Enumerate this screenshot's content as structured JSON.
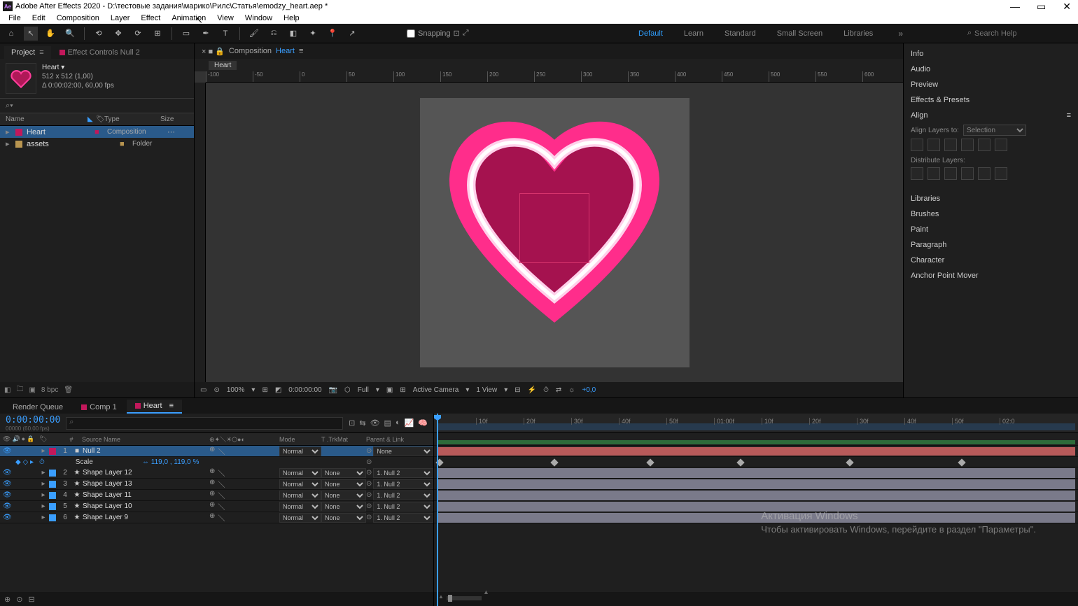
{
  "app": {
    "title": "Adobe After Effects 2020 - D:\\тестовые задания\\марико\\Рилс\\Статья\\emodzy_heart.aep *"
  },
  "menu": [
    "File",
    "Edit",
    "Composition",
    "Layer",
    "Effect",
    "Animation",
    "View",
    "Window",
    "Help"
  ],
  "toolbar": {
    "snapping_label": "Snapping"
  },
  "workspaces": {
    "default": "Default",
    "learn": "Learn",
    "standard": "Standard",
    "small": "Small Screen",
    "libraries": "Libraries"
  },
  "search": {
    "placeholder": "Search Help"
  },
  "project": {
    "tab_project": "Project",
    "tab_effects": "Effect Controls Null 2",
    "comp_name": "Heart ▾",
    "comp_dims": "512 x 512 (1,00)",
    "comp_dur": "Δ 0:00:02:00, 60,00 fps",
    "filter": "⌕▾",
    "head_name": "Name",
    "head_type": "Type",
    "head_size": "Size",
    "items": [
      {
        "name": "Heart",
        "type": "Composition",
        "folder": false,
        "selected": true
      },
      {
        "name": "assets",
        "type": "Folder",
        "folder": true,
        "selected": false
      }
    ],
    "footer_bpc": "8 bpc"
  },
  "comp": {
    "tab_label": "Composition",
    "tab_name": "Heart",
    "breadcrumb": "Heart",
    "ruler_ticks": [
      "-100",
      "-50",
      "0",
      "50",
      "100",
      "150",
      "200",
      "250",
      "300",
      "350",
      "400",
      "450",
      "500",
      "550",
      "600"
    ],
    "footer": {
      "zoom": "100%",
      "time": "0:00:00:00",
      "res": "Full",
      "camera": "Active Camera",
      "view": "1 View",
      "exp": "+0,0"
    }
  },
  "right": {
    "info": "Info",
    "audio": "Audio",
    "preview": "Preview",
    "effects": "Effects & Presets",
    "align": "Align",
    "align_to": "Align Layers to:",
    "align_sel": "Selection",
    "distribute": "Distribute Layers:",
    "libraries": "Libraries",
    "brushes": "Brushes",
    "paint": "Paint",
    "paragraph": "Paragraph",
    "character": "Character",
    "anchor": "Anchor Point Mover"
  },
  "timeline": {
    "tab_rq": "Render Queue",
    "tab_c1": "Comp 1",
    "tab_heart": "Heart",
    "timecode": "0:00:00:00",
    "timecode_sub": "00000 (60.00 fps)",
    "col_source": "Source Name",
    "col_mode": "Mode",
    "col_trk": "T  .TrkMat",
    "col_parent": "Parent & Link",
    "ruler": [
      "10f",
      "20f",
      "30f",
      "40f",
      "50f",
      "01:00f",
      "10f",
      "20f",
      "30f",
      "40f",
      "50f",
      "02:0"
    ],
    "layers": [
      {
        "idx": 1,
        "name": "Null 2",
        "color": "#c2185b",
        "icon": "■",
        "mode": "Normal",
        "trk": "",
        "parent": "None",
        "sel": true
      },
      {
        "idx": 2,
        "name": "Shape Layer 12",
        "color": "#3a9eff",
        "icon": "★",
        "mode": "Normal",
        "trk": "None",
        "parent": "1. Null 2"
      },
      {
        "idx": 3,
        "name": "Shape Layer 13",
        "color": "#3a9eff",
        "icon": "★",
        "mode": "Normal",
        "trk": "None",
        "parent": "1. Null 2"
      },
      {
        "idx": 4,
        "name": "Shape Layer 11",
        "color": "#3a9eff",
        "icon": "★",
        "mode": "Normal",
        "trk": "None",
        "parent": "1. Null 2"
      },
      {
        "idx": 5,
        "name": "Shape Layer 10",
        "color": "#3a9eff",
        "icon": "★",
        "mode": "Normal",
        "trk": "None",
        "parent": "1. Null 2"
      },
      {
        "idx": 6,
        "name": "Shape Layer 9",
        "color": "#3a9eff",
        "icon": "★",
        "mode": "Normal",
        "trk": "None",
        "parent": "1. Null 2"
      }
    ],
    "prop": {
      "name": "Scale",
      "value": "119,0 , 119,0 %"
    },
    "kf_positions": [
      4,
      168,
      305,
      434,
      590,
      750
    ]
  },
  "watermark": {
    "title": "Активация Windows",
    "sub": "Чтобы активировать Windows, перейдите в раздел \"Параметры\"."
  }
}
